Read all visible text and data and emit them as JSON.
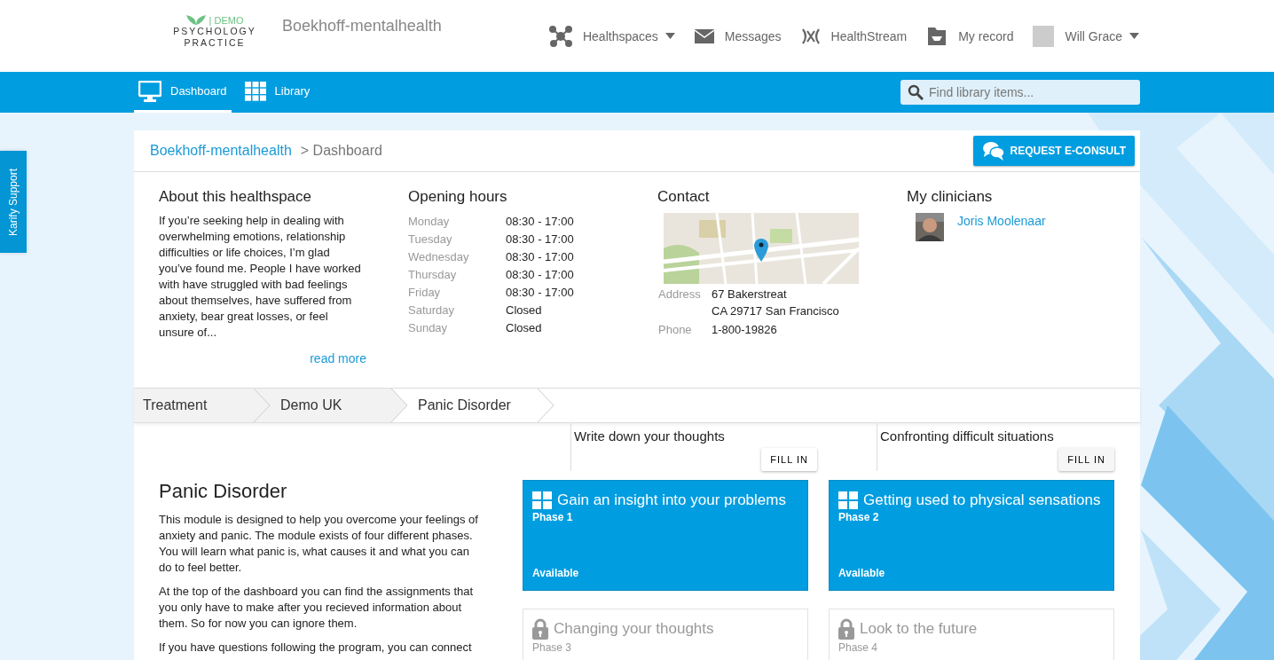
{
  "header": {
    "logo": {
      "tag": "| DEMO",
      "line1": "PSYCHOLOGY",
      "line2": "PRACTICE"
    },
    "title": "Boekhoff-mentalhealth",
    "nav": [
      {
        "label": "Healthspaces",
        "dropdown": true
      },
      {
        "label": "Messages",
        "dropdown": false
      },
      {
        "label": "HealthStream",
        "dropdown": false
      },
      {
        "label": "My record",
        "dropdown": false
      }
    ],
    "user": {
      "name": "Will Grace",
      "dropdown": true
    }
  },
  "tabs": [
    {
      "label": "Dashboard",
      "selected": true
    },
    {
      "label": "Library",
      "selected": false
    }
  ],
  "search": {
    "placeholder": "Find library items..."
  },
  "support_tab": "Karify Support",
  "breadcrumb": {
    "link": "Boekhoff-mentalhealth",
    "current": "> Dashboard"
  },
  "consult_button": "REQUEST E-CONSULT",
  "about": {
    "title": "About this healthspace",
    "text": "If you’re seeking help in dealing with overwhelming emotions, relationship difficulties or life choices, I’m glad you’ve found me. People I have worked with have struggled with bad feelings about themselves, have suffered from anxiety, bear great losses, or feel unsure of...",
    "link": "read more"
  },
  "hours": {
    "title": "Opening hours",
    "rows": [
      {
        "day": "Monday",
        "time": "08:30 - 17:00"
      },
      {
        "day": "Tuesday",
        "time": "08:30 - 17:00"
      },
      {
        "day": "Wednesday",
        "time": "08:30 - 17:00"
      },
      {
        "day": "Thursday",
        "time": "08:30 - 17:00"
      },
      {
        "day": "Friday",
        "time": "08:30 - 17:00"
      },
      {
        "day": "Saturday",
        "time": "Closed"
      },
      {
        "day": "Sunday",
        "time": "Closed"
      }
    ]
  },
  "contact": {
    "title": "Contact",
    "rows": [
      {
        "label": "Address",
        "lines": [
          "67 Bakerstreat",
          "CA 29717 San Francisco"
        ]
      },
      {
        "label": "Phone",
        "lines": [
          "1-800-19826"
        ]
      }
    ]
  },
  "clinicians": {
    "title": "My clinicians",
    "items": [
      {
        "name": "Joris Moolenaar"
      }
    ]
  },
  "steps": [
    {
      "label": "Treatment",
      "selected": false
    },
    {
      "label": "Demo UK",
      "selected": false
    },
    {
      "label": "Panic Disorder",
      "selected": true
    }
  ],
  "module": {
    "title": "Panic Disorder",
    "paragraphs": [
      "This module is designed to help you overcome your feelings of anxiety and panic. The module exists of four different phases. You will learn what panic is, what causes it and what you can do to feel better.",
      "At the top of the dashboard you can find the assignments that you only have to make after you recieved information about them. So for now you can ignore them.",
      "If you have questions following the program, you can connect"
    ]
  },
  "assignments": [
    {
      "title": "Write down your thoughts",
      "button": "FILL IN"
    },
    {
      "title": "Confronting difficult situations",
      "button": "FILL IN"
    }
  ],
  "phases": [
    {
      "title": "Gain an insight into your problems",
      "phase": "Phase 1",
      "status": "Available",
      "locked": false
    },
    {
      "title": "Getting used to physical sensations",
      "phase": "Phase 2",
      "status": "Available",
      "locked": false
    },
    {
      "title": "Changing your thoughts",
      "phase": "Phase 3",
      "locked": true
    },
    {
      "title": "Look to the future",
      "phase": "Phase 4",
      "locked": true
    }
  ]
}
